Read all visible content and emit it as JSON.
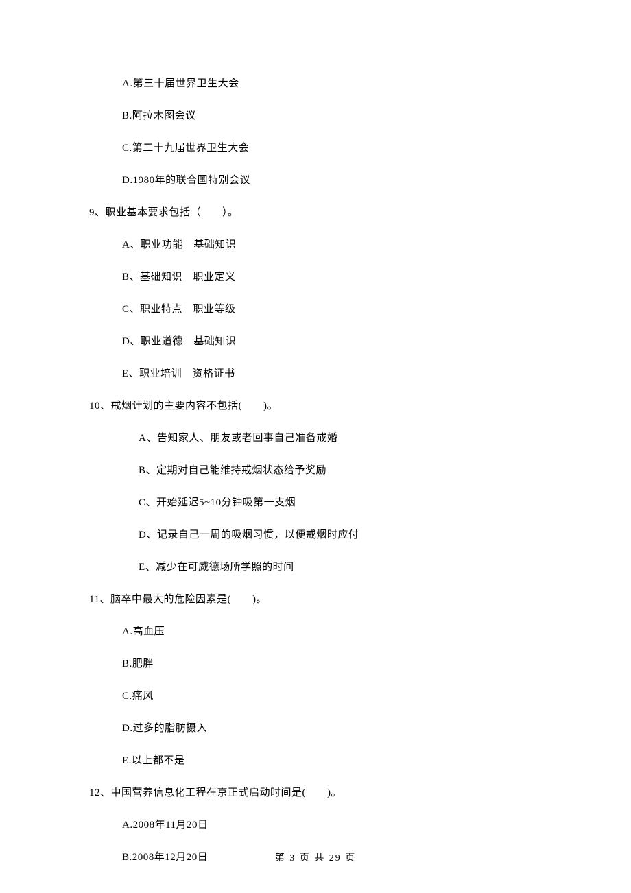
{
  "q8_options": {
    "A": "A.第三十届世界卫生大会",
    "B": "B.阿拉木图会议",
    "C": "C.第二十九届世界卫生大会",
    "D": "D.1980年的联合国特别会议"
  },
  "q9": {
    "stem": "9、职业基本要求包括（　　）。",
    "options": {
      "A": "A、职业功能　基础知识",
      "B": "B、基础知识　职业定义",
      "C": "C、职业特点　职业等级",
      "D": "D、职业道德　基础知识",
      "E": "E、职业培训　资格证书"
    }
  },
  "q10": {
    "stem": "10、戒烟计划的主要内容不包括(　　)。",
    "options": {
      "A": "A、告知家人、朋友或者回事自己准备戒婚",
      "B": "B、定期对自己能维持戒烟状态给予奖励",
      "C": "C、开始延迟5~10分钟吸第一支烟",
      "D": "D、记录自己一周的吸烟习惯，以便戒烟时应付",
      "E": "E、减少在可威德场所学照的时间"
    }
  },
  "q11": {
    "stem": "11、脑卒中最大的危险因素是(　　)。",
    "options": {
      "A": "A.高血压",
      "B": "B.肥胖",
      "C": "C.痛风",
      "D": "D.过多的脂肪摄入",
      "E": "E.以上都不是"
    }
  },
  "q12": {
    "stem": "12、中国营养信息化工程在京正式启动时间是(　　)。",
    "options": {
      "A": "A.2008年11月20日",
      "B": "B.2008年12月20日"
    }
  },
  "footer": "第 3 页 共 29 页"
}
